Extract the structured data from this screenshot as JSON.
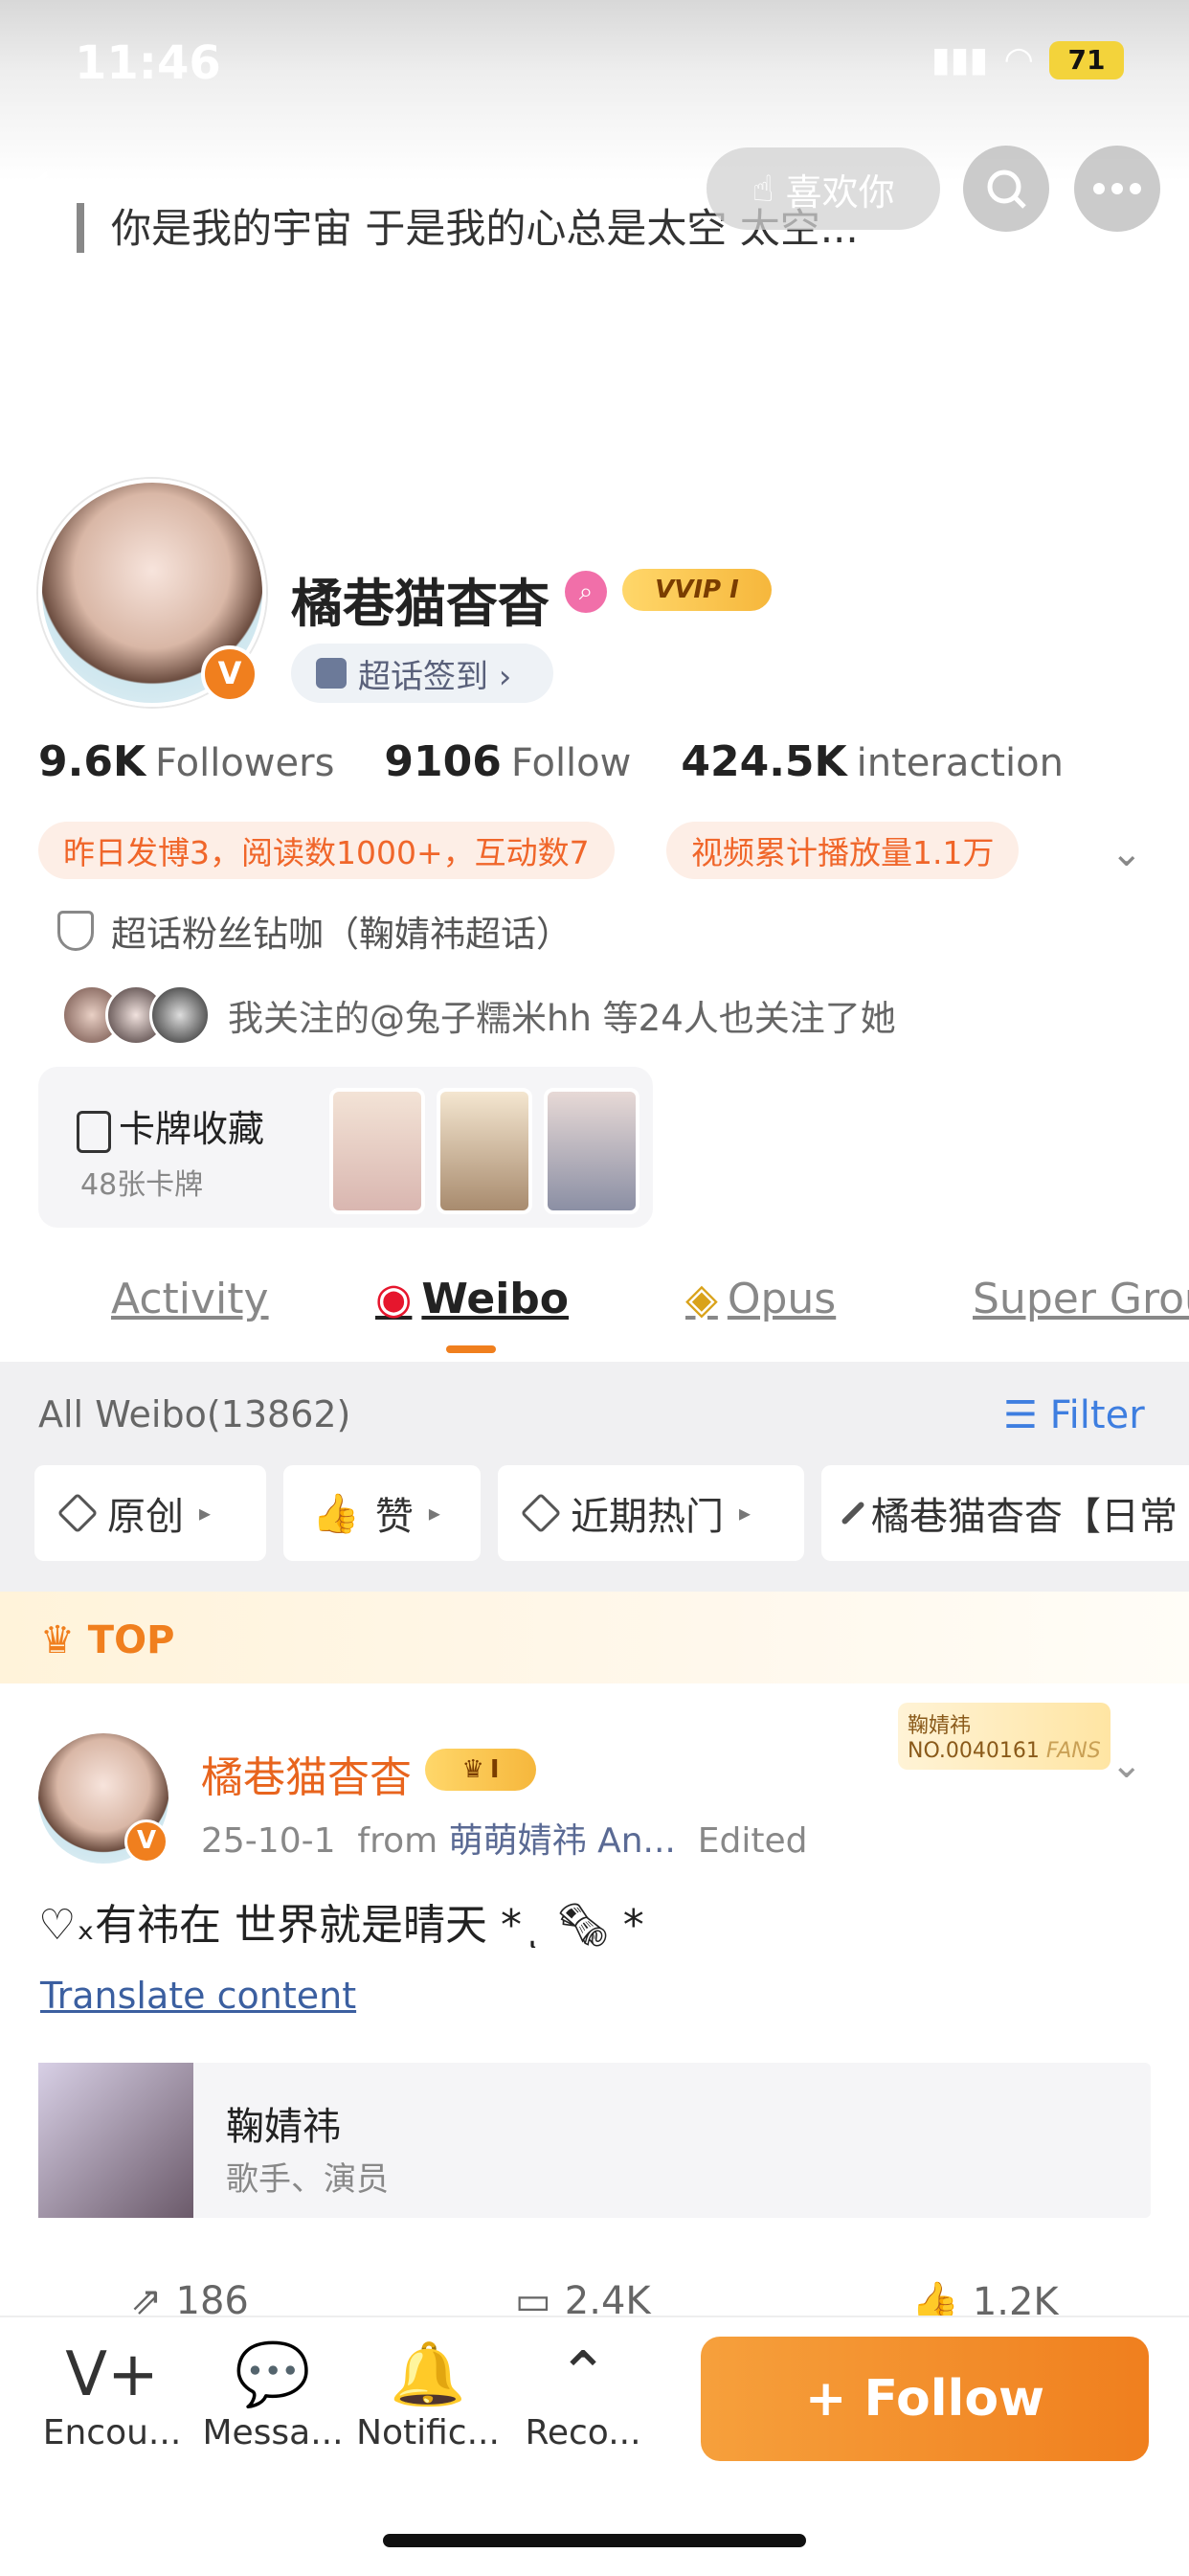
{
  "status": {
    "time": "11:46",
    "battery": "71"
  },
  "header": {
    "quote": "你是我的宇宙 于是我的心总是太空 太空...",
    "like_label": "喜欢你"
  },
  "profile": {
    "name": "橘巷猫杳杳",
    "vip_label": "VVIP I",
    "checkin_label": "超话签到 ›",
    "stats": {
      "followers_value": "9.6K",
      "followers_label": "Followers",
      "follow_value": "9106",
      "follow_label": "Follow",
      "interaction_value": "424.5K",
      "interaction_label": "interaction"
    },
    "tags": [
      "昨日发博3，阅读数1000+，互动数7",
      "视频累计播放量1.1万"
    ],
    "fan_title": "超话粉丝钻咖（鞠婧祎超话）",
    "mutual_text": "我关注的@兔子糯米hh 等24人也关注了她",
    "cards": {
      "title": "卡牌收藏",
      "subtitle": "48张卡牌"
    }
  },
  "tabs": [
    "Activity",
    "Weibo",
    "Opus",
    "Super Grou"
  ],
  "feed": {
    "all_label": "All Weibo(13862)",
    "filter_label": "Filter",
    "chips": [
      "原创",
      "赞",
      "近期热门",
      "橘巷猫杳杳【日常"
    ]
  },
  "top_post": {
    "top_label": "TOP",
    "fans_badge_name": "鞠婧祎",
    "fans_badge_no": "NO.0040161",
    "fans_badge_word": "FANS",
    "author": "橘巷猫杳杳",
    "author_vip": "I",
    "date": "25-10-1",
    "from_word": "from",
    "source": "萌萌婧祎 An...",
    "edited": "Edited",
    "text": "♡ₓ有祎在 世界就是晴天 *ͺ 🗞 *",
    "translate_label": "Translate content",
    "ref_title": "鞠婧祎",
    "ref_subtitle": "歌手、演员",
    "reposts": "186",
    "comments": "2.4K",
    "likes": "1.2K"
  },
  "bottom_bar": {
    "items": [
      "Encou...",
      "Messa...",
      "Notific...",
      "Reco..."
    ],
    "follow_label": "+ Follow"
  },
  "colors": {
    "accent": "#f07f1e",
    "link": "#3e7ee0",
    "tag_bg": "#fdeee6"
  }
}
